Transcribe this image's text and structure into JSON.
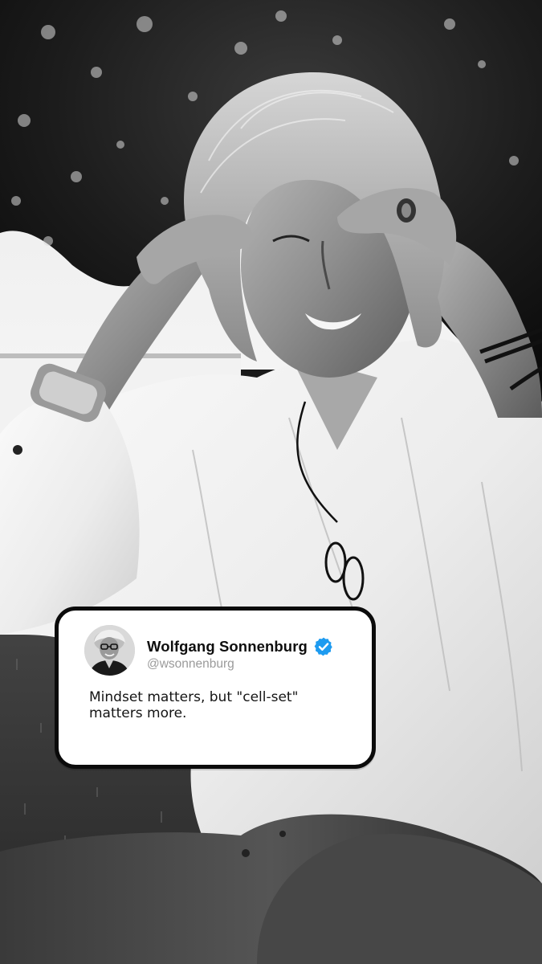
{
  "tweet": {
    "display_name": "Wolfgang Sonnenburg",
    "handle": "@wsonnenburg",
    "text": "Mindset matters, but \"cell-set\" matters more.",
    "verified": true,
    "verified_color": "#1d9bf0"
  },
  "icons": {
    "verified": "verified-badge-icon",
    "avatar": "profile-photo"
  }
}
